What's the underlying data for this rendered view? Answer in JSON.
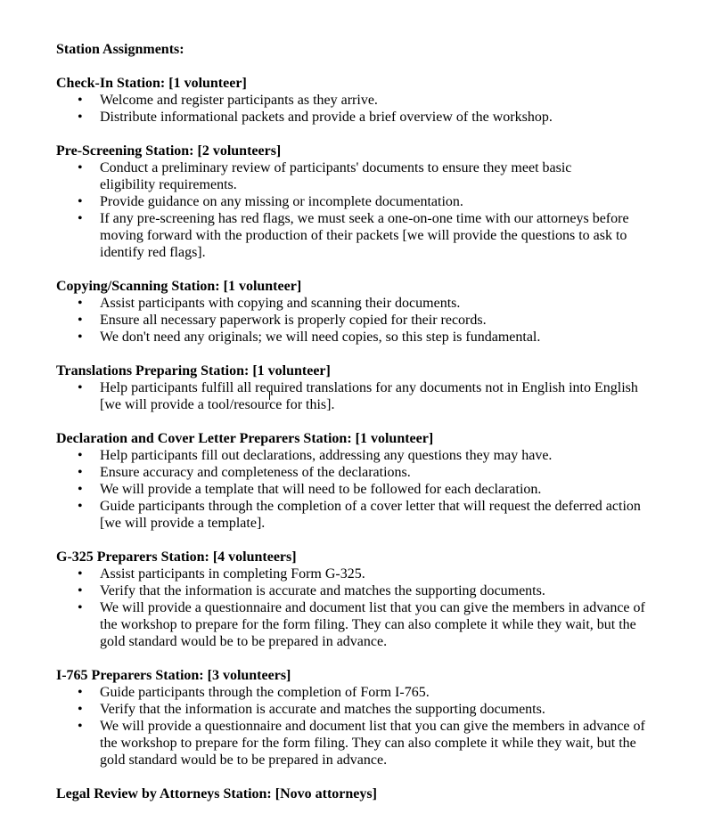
{
  "document": {
    "title": "Station Assignments:",
    "sections": [
      {
        "heading": "Check-In Station: [1 volunteer]",
        "items": [
          "Welcome and register participants as they arrive.",
          "Distribute informational packets and provide a brief overview of the workshop."
        ]
      },
      {
        "heading": "Pre-Screening Station: [2 volunteers]",
        "items": [
          "Conduct a preliminary review of participants' documents to ensure they meet basic eligibility requirements.",
          "Provide guidance on any missing or incomplete documentation.",
          "If any pre-screening has red flags, we must seek a one-on-one time with our attorneys before moving forward with the production of their packets [we will provide the questions to ask to identify red flags]."
        ]
      },
      {
        "heading": "Copying/Scanning Station: [1 volunteer]",
        "items": [
          "Assist participants with copying and scanning their documents.",
          "Ensure all necessary paperwork is properly copied for their records.",
          "We don't need any originals; we will need copies, so this step is fundamental."
        ]
      },
      {
        "heading": "Translations Preparing Station: [1 volunteer]",
        "items": [
          "Help participants fulfill all required translations for any documents not in English into English [we will provide a tool/resource for this]."
        ]
      },
      {
        "heading": "Declaration and Cover Letter Preparers Station: [1 volunteer]",
        "items": [
          "Help participants fill out declarations, addressing any questions they may have.",
          "Ensure accuracy and completeness of the declarations.",
          "We will provide a template that will need to be followed for each declaration.",
          "Guide participants through the completion of a cover letter that will request the deferred action [we will provide a template]."
        ]
      },
      {
        "heading": "G-325 Preparers Station: [4 volunteers]",
        "items": [
          "Assist participants in completing Form G-325.",
          "Verify that the information is accurate and matches the supporting documents.",
          "We will provide a questionnaire and document list that you can give the members in advance of the workshop to prepare for the form filing. They can also complete it while they wait, but the gold standard would be to be prepared in advance."
        ]
      },
      {
        "heading": "I-765 Preparers Station: [3 volunteers]",
        "items": [
          "Guide participants through the completion of Form I-765.",
          "Verify that the information is accurate and matches the supporting documents.",
          "We will provide a questionnaire and document list that you can give the members in advance of the workshop to prepare for the form filing. They can also complete it while they wait, but the gold standard would be to be prepared in advance."
        ]
      },
      {
        "heading": "Legal Review by Attorneys Station: [Novo attorneys]",
        "items": []
      }
    ]
  }
}
